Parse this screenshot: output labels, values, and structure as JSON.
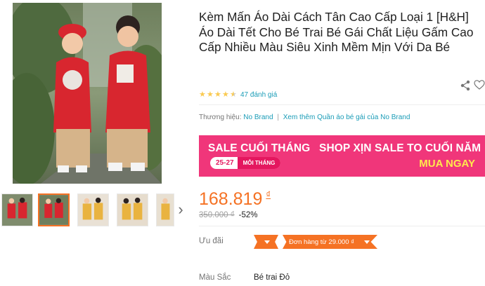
{
  "product": {
    "title": "Kèm Mấn Áo Dài Cách Tân Cao Cấp Loại 1 [H&H] Áo Dài Tết Cho Bé Trai Bé Gái Chất Liệu Gấm Cao Cấp Nhiều Màu Siêu Xinh Mềm Mịn Với Da Bé",
    "rating": {
      "stars": 4.5,
      "count_label": "47 đánh giá"
    },
    "brand": {
      "label": "Thương hiệu:",
      "name": "No Brand",
      "separator": "|",
      "more_link": "Xem thêm Quần áo bé gái của No Brand"
    },
    "price": {
      "current": "168.819",
      "currency": "₫",
      "original": "350.000 ₫",
      "discount": "-52%"
    },
    "promotions": {
      "label": "Ưu đãi",
      "voucher": "Đơn hàng từ 29.000 ₫"
    },
    "color": {
      "label": "Màu Sắc",
      "value": "Bé trai Đỏ"
    }
  },
  "banner": {
    "left_title": "SALE CUỐI THÁNG",
    "date_range": "25-27",
    "period": "MỖI THÁNG",
    "right_title": "SHOP XỊN SALE TO CUỐI NĂM",
    "cta": "MUA NGAY"
  },
  "gallery": {
    "thumbnail_count": 5,
    "active_index": 1
  },
  "icons": {
    "share": "share-icon",
    "wishlist": "heart-icon",
    "next": "chevron-right-icon"
  },
  "colors": {
    "accent": "#f57224",
    "link": "#1a9cb7",
    "banner": "#f0367a",
    "star": "#faca51"
  }
}
